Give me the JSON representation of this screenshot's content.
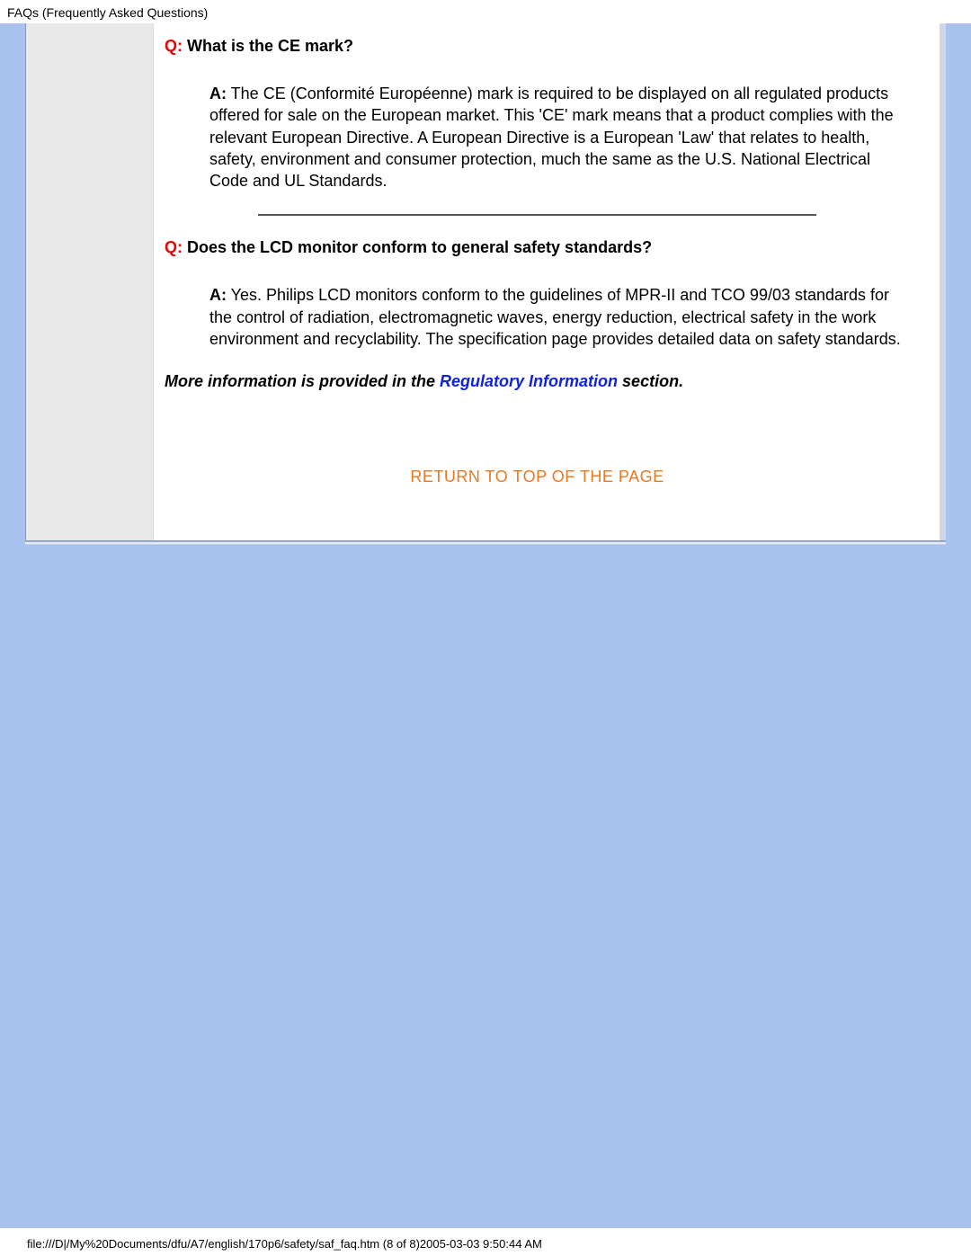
{
  "header": {
    "title": "FAQs (Frequently Asked Questions)"
  },
  "faqs": [
    {
      "q_prefix": "Q:",
      "question": " What is the CE mark?",
      "a_prefix": "A:",
      "answer": " The CE (Conformité Européenne) mark is required to be displayed on all regulated products offered for sale on the European market. This 'CE' mark means that a product complies with the relevant European Directive. A European Directive is a European 'Law' that relates to health, safety, environment and consumer protection, much the same as the U.S. National Electrical Code and UL Standards."
    },
    {
      "q_prefix": "Q:",
      "question": " Does the LCD monitor conform to general safety standards?",
      "a_prefix": "A:",
      "answer": " Yes. Philips LCD monitors conform to the guidelines of MPR-II and TCO 99/03 standards for the control of radiation, electromagnetic waves, energy reduction, electrical safety in the work environment and recyclability. The specification page provides detailed data on safety standards."
    }
  ],
  "more_info": {
    "prefix": "More information is provided in the ",
    "link_text": "Regulatory Information",
    "suffix": " section."
  },
  "return_link": "RETURN TO TOP OF THE PAGE",
  "footer": "file:///D|/My%20Documents/dfu/A7/english/170p6/safety/saf_faq.htm (8 of 8)2005-03-03 9:50:44 AM"
}
